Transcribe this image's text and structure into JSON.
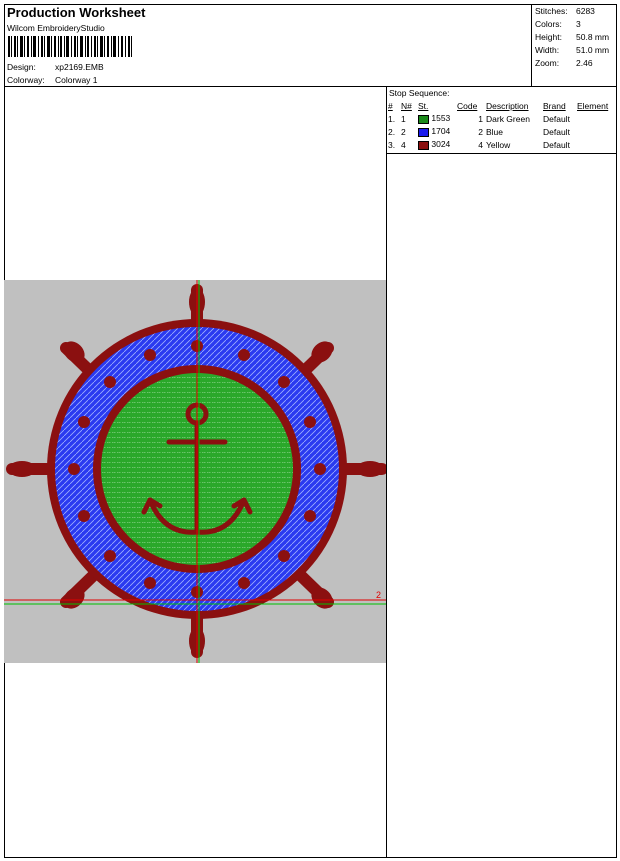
{
  "header": {
    "title": "Production Worksheet",
    "studio": "Wilcom  EmbroideryStudio",
    "design_label": "Design:",
    "design_value": "xp2169.EMB",
    "colorway_label": "Colorway:",
    "colorway_value": "Colorway  1"
  },
  "stats": {
    "stitches_label": "Stitches:",
    "stitches_value": "6283",
    "colors_label": "Colors:",
    "colors_value": "3",
    "height_label": "Height:",
    "height_value": "50.8 mm",
    "width_label": "Width:",
    "width_value": "51.0 mm",
    "zoom_label": "Zoom:",
    "zoom_value": "2.46"
  },
  "stop_sequence": {
    "title": "Stop  Sequence:",
    "headers": [
      "#",
      "N#",
      "St.",
      "Code",
      "Description",
      "Brand",
      "Element"
    ],
    "rows": [
      {
        "num": "1.",
        "n": "1",
        "color": "#1a8a1a",
        "st": "1553",
        "code": "1",
        "description": "Dark Green",
        "brand": "Default",
        "element": ""
      },
      {
        "num": "2.",
        "n": "2",
        "color": "#1a1aee",
        "st": "1704",
        "code": "2",
        "description": "Blue",
        "brand": "Default",
        "element": ""
      },
      {
        "num": "3.",
        "n": "4",
        "color": "#8b1010",
        "st": "3024",
        "code": "4",
        "description": "Yellow",
        "brand": "Default",
        "element": ""
      }
    ]
  },
  "design": {
    "marker_label": "2",
    "colors": {
      "background": "#c0c0c0",
      "green": "#2aa82a",
      "blue": "#2a3af0",
      "maroon": "#8b1010",
      "guide_red": "#e00000",
      "guide_green": "#00c000"
    }
  }
}
